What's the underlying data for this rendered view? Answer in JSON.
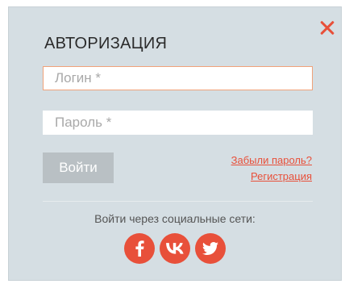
{
  "modal": {
    "title": "АВТОРИЗАЦИЯ",
    "close_icon": "close-icon",
    "accent_color": "#e8503a",
    "background_color": "#d5dee3"
  },
  "form": {
    "login": {
      "value": "",
      "placeholder": "Логин *"
    },
    "password": {
      "value": "",
      "placeholder": "Пароль *"
    },
    "submit_label": "Войти"
  },
  "links": {
    "forgot_password": "Забыли пароль?",
    "register": "Регистрация"
  },
  "social": {
    "label": "Войти через социальные сети:",
    "networks": [
      {
        "name": "facebook",
        "icon": "facebook-icon",
        "glyph": "f"
      },
      {
        "name": "vk",
        "icon": "vk-icon",
        "glyph": "vk"
      },
      {
        "name": "twitter",
        "icon": "twitter-icon",
        "glyph": "bird"
      }
    ]
  }
}
